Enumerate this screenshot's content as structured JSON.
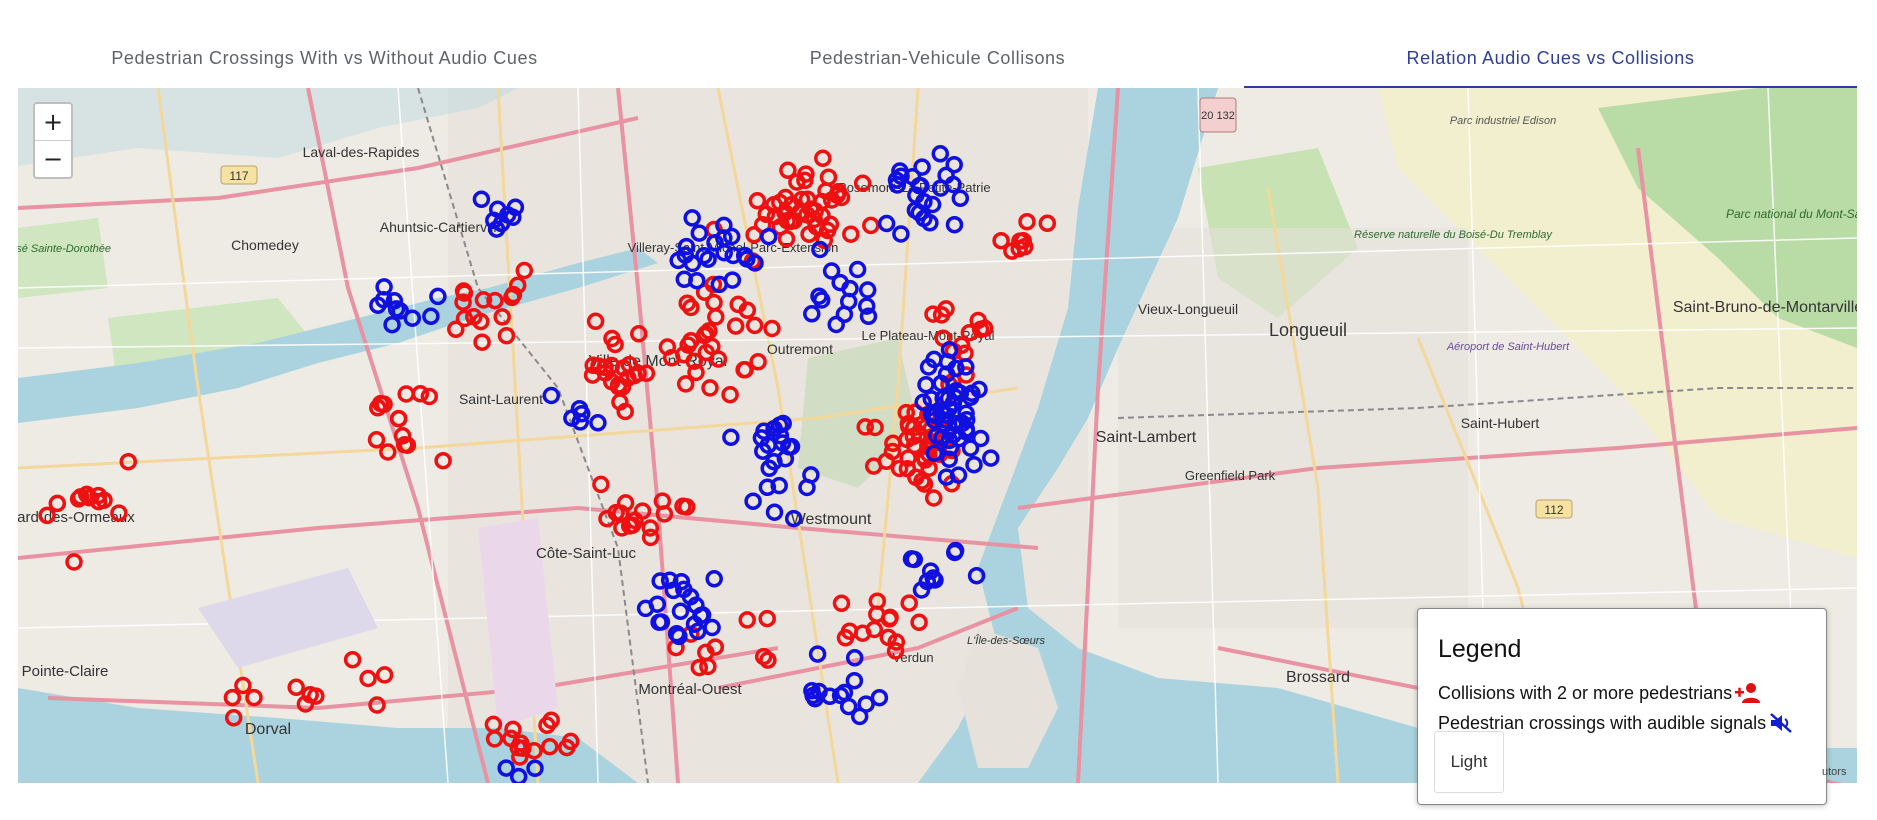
{
  "tabs": [
    {
      "label": "Pedestrian Crossings With vs Without Audio Cues",
      "active": false
    },
    {
      "label": "Pedestrian-Vehicule Collisons",
      "active": false
    },
    {
      "label": "Relation Audio Cues vs Collisions",
      "active": true
    }
  ],
  "zoom": {
    "in_label": "+",
    "out_label": "−"
  },
  "map": {
    "places": [
      {
        "name": "Laval-des-Rapides"
      },
      {
        "name": "Chomedey"
      },
      {
        "name": "Ahuntsic-Cartierville"
      },
      {
        "name": "Parc industriel Edison"
      },
      {
        "name": "Réserve naturelle du Boisé-Du Tremblay"
      },
      {
        "name": "Parc national du Mont-Saint-Bruno"
      },
      {
        "name": "Saint-Bruno-de-Montarville"
      },
      {
        "name": "Vieux-Longueuil"
      },
      {
        "name": "Longueuil"
      },
      {
        "name": "Aéroport de Saint-Hubert"
      },
      {
        "name": "Saint-Hubert"
      },
      {
        "name": "Saint-Lambert"
      },
      {
        "name": "Greenfield Park"
      },
      {
        "name": "Brossard"
      },
      {
        "name": "Ville de Mont-Royal"
      },
      {
        "name": "Saint-Laurent"
      },
      {
        "name": "Outremont"
      },
      {
        "name": "Westmount"
      },
      {
        "name": "Côte-Saint-Luc"
      },
      {
        "name": "Dollard-des-Ormeaux"
      },
      {
        "name": "Pointe-Claire"
      },
      {
        "name": "Dorval"
      },
      {
        "name": "Montréal-Ouest"
      },
      {
        "name": "Verdun"
      },
      {
        "name": "L'Île-des-Sœurs"
      },
      {
        "name": "Rosemont-La Petite-Patrie"
      },
      {
        "name": "Villeray-Saint-Michel-Parc-Extension"
      },
      {
        "name": "Le Plateau-Mont-Royal"
      },
      {
        "name": "Le Boisé Sainte-Dorothée"
      }
    ],
    "highway_shields": [
      "117",
      "20 132",
      "112"
    ],
    "collision_color": "#ee1111",
    "audio_crossing_color": "#1010e0",
    "attribution": "utors"
  },
  "legend": {
    "title": "Legend",
    "collisions_label": "Collisions with 2 or more pedestrians",
    "collisions_icon": "person-add-icon",
    "audio_label": "Pedestrian crossings with audible signals",
    "audio_icon": "volume-off-icon",
    "theme_button": "Light"
  }
}
